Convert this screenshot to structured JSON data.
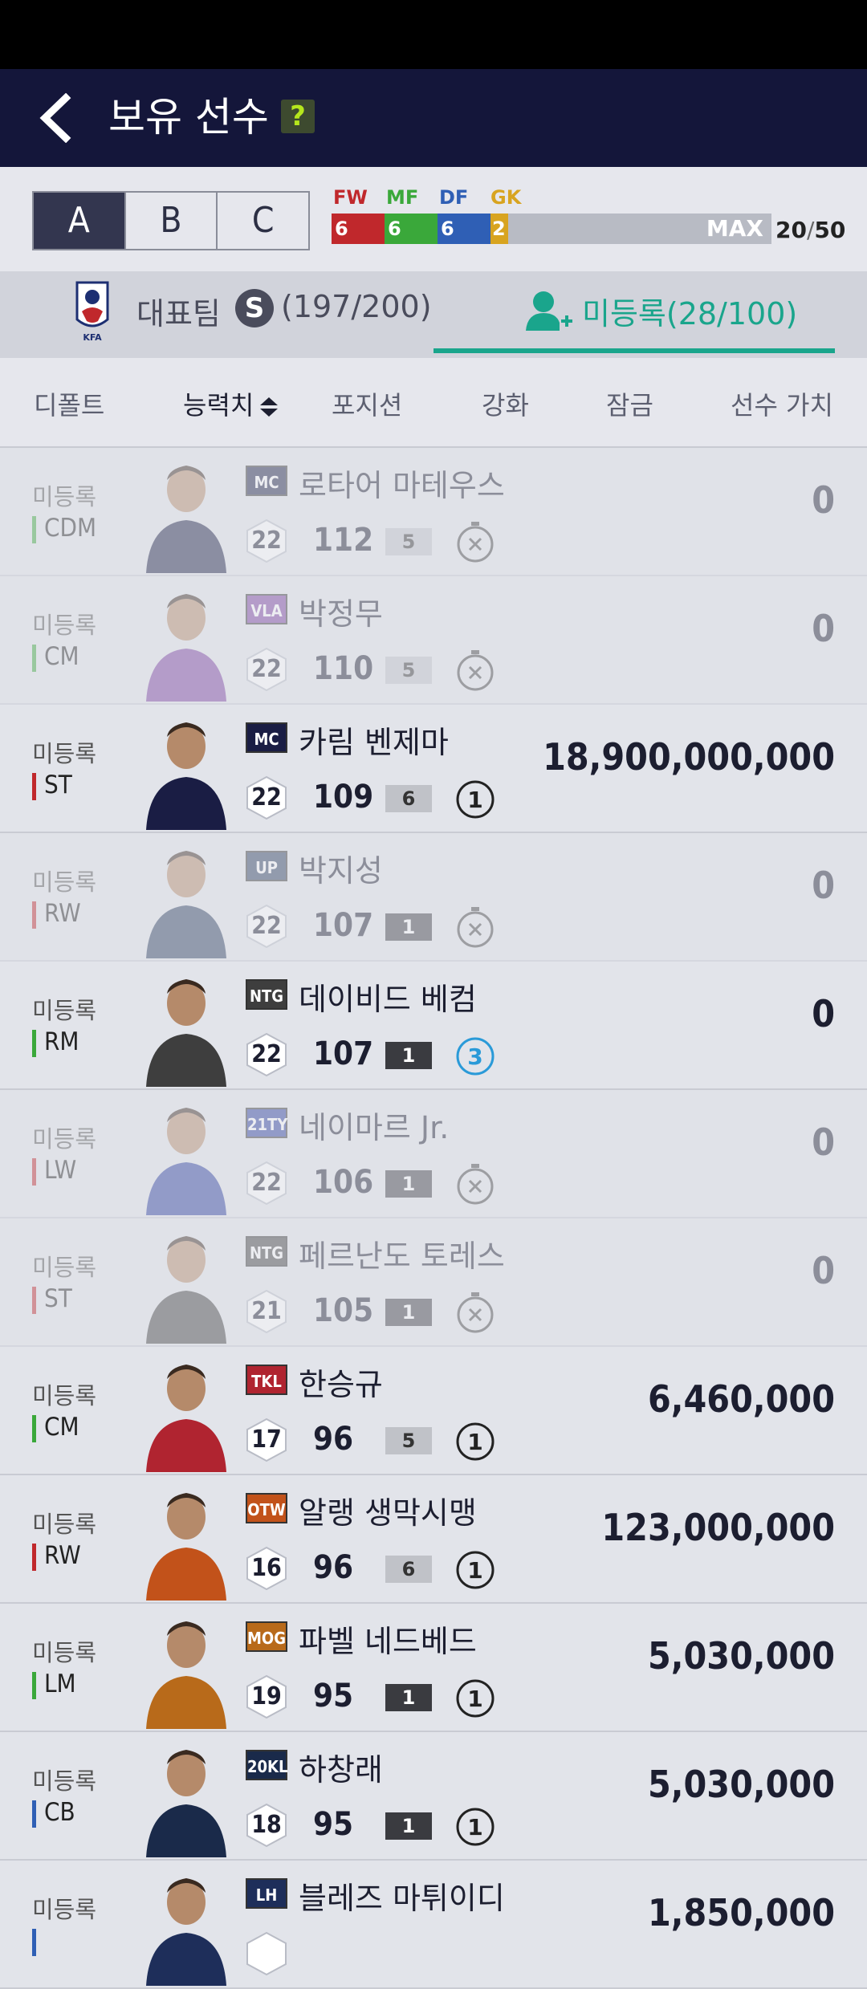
{
  "header": {
    "title": "보유 선수",
    "help": "?"
  },
  "squad_tabs": [
    "A",
    "B",
    "C"
  ],
  "position_summary": {
    "labels": [
      {
        "name": "FW",
        "value": "6",
        "color": "#c0282c"
      },
      {
        "name": "MF",
        "value": "6",
        "color": "#3aa83a"
      },
      {
        "name": "DF",
        "value": "6",
        "color": "#2f5fb5"
      },
      {
        "name": "GK",
        "value": "2",
        "color": "#d8a420"
      }
    ],
    "max_label": "MAX",
    "current": "20",
    "total": "50"
  },
  "team_tabs": {
    "national": "대표팀",
    "national_badge": "S",
    "national_count": "(197/200)",
    "national_logo_text": "KFA",
    "unregistered": "미등록(28/100)"
  },
  "sort_tabs": [
    "디폴트",
    "능력치",
    "포지션",
    "강화",
    "잠금",
    "선수 가치"
  ],
  "players": [
    {
      "status": "미등록",
      "position": "CDM",
      "pos_color": "#3aa83a",
      "season": "MC",
      "season_color": "#1a1d44",
      "name": "로타어 마테우스",
      "level": "22",
      "ovr": "112",
      "upgrade": "5",
      "upgrade_style": "silver",
      "trade": "",
      "price": "0",
      "dim": true
    },
    {
      "status": "미등록",
      "position": "CM",
      "pos_color": "#3aa83a",
      "season": "VLA",
      "season_color": "#7a3fa0",
      "name": "박정무",
      "level": "22",
      "ovr": "110",
      "upgrade": "5",
      "upgrade_style": "silver",
      "trade": "",
      "price": "0",
      "dim": true
    },
    {
      "status": "미등록",
      "position": "ST",
      "pos_color": "#c0282c",
      "season": "MC",
      "season_color": "#1a1d44",
      "name": "카림 벤제마",
      "level": "22",
      "ovr": "109",
      "upgrade": "6",
      "upgrade_style": "silver",
      "trade": "1",
      "price": "18,900,000,000",
      "dim": false
    },
    {
      "status": "미등록",
      "position": "RW",
      "pos_color": "#c0282c",
      "season": "UP",
      "season_color": "#2a3c5e",
      "name": "박지성",
      "level": "22",
      "ovr": "107",
      "upgrade": "1",
      "upgrade_style": "dark",
      "trade": "",
      "price": "0",
      "dim": true
    },
    {
      "status": "미등록",
      "position": "RM",
      "pos_color": "#3aa83a",
      "season": "NTG",
      "season_color": "#3e3e3e",
      "name": "데이비드 베컴",
      "level": "22",
      "ovr": "107",
      "upgrade": "1",
      "upgrade_style": "dark",
      "trade": "3",
      "price": "0",
      "dim": false
    },
    {
      "status": "미등록",
      "position": "LW",
      "pos_color": "#c0282c",
      "season": "21TY",
      "season_color": "#2a3c9e",
      "name": "네이마르 Jr.",
      "level": "22",
      "ovr": "106",
      "upgrade": "1",
      "upgrade_style": "dark",
      "trade": "",
      "price": "0",
      "dim": true
    },
    {
      "status": "미등록",
      "position": "ST",
      "pos_color": "#c0282c",
      "season": "NTG",
      "season_color": "#3e3e3e",
      "name": "페르난도 토레스",
      "level": "21",
      "ovr": "105",
      "upgrade": "1",
      "upgrade_style": "dark",
      "trade": "",
      "price": "0",
      "dim": true
    },
    {
      "status": "미등록",
      "position": "CM",
      "pos_color": "#3aa83a",
      "season": "TKL",
      "season_color": "#b02430",
      "name": "한승규",
      "level": "17",
      "ovr": "96",
      "upgrade": "5",
      "upgrade_style": "silver",
      "trade": "1",
      "price": "6,460,000",
      "dim": false
    },
    {
      "status": "미등록",
      "position": "RW",
      "pos_color": "#c0282c",
      "season": "OTW",
      "season_color": "#c2521a",
      "name": "알랭 생막시맹",
      "level": "16",
      "ovr": "96",
      "upgrade": "6",
      "upgrade_style": "silver",
      "trade": "1",
      "price": "123,000,000",
      "dim": false
    },
    {
      "status": "미등록",
      "position": "LM",
      "pos_color": "#3aa83a",
      "season": "MOG",
      "season_color": "#b86a1a",
      "name": "파벨 네드베드",
      "level": "19",
      "ovr": "95",
      "upgrade": "1",
      "upgrade_style": "dark",
      "trade": "1",
      "price": "5,030,000",
      "dim": false
    },
    {
      "status": "미등록",
      "position": "CB",
      "pos_color": "#2f5fb5",
      "season": "20KL",
      "season_color": "#1a2a4a",
      "name": "하창래",
      "level": "18",
      "ovr": "95",
      "upgrade": "1",
      "upgrade_style": "dark",
      "trade": "1",
      "price": "5,030,000",
      "dim": false
    },
    {
      "status": "미등록",
      "position": "",
      "pos_color": "#2f5fb5",
      "season": "LH",
      "season_color": "#1e2e5a",
      "name": "블레즈 마튀이디",
      "level": "",
      "ovr": "",
      "upgrade": "",
      "upgrade_style": "dark",
      "trade": "",
      "price": "1,850,000",
      "dim": false
    }
  ]
}
